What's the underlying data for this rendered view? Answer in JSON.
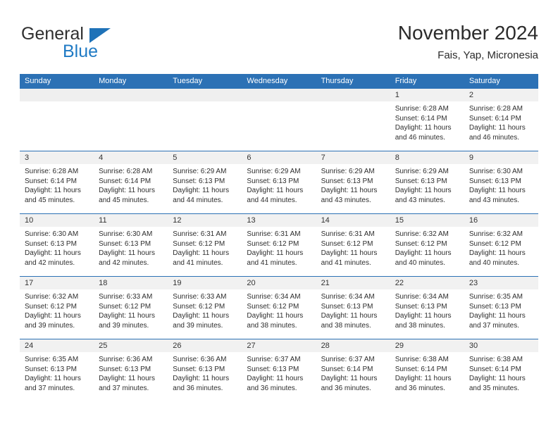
{
  "brand": {
    "word_one": "General",
    "word_two": "Blue",
    "triangle_color": "#1f72b8",
    "blue_color": "#1f7ac4"
  },
  "header": {
    "title": "November 2024",
    "subtitle": "Fais, Yap, Micronesia"
  },
  "theme": {
    "header_blue": "#2c71b5",
    "date_band_gray": "#f1f1f1",
    "text": "#2e2e2e"
  },
  "weekdays": [
    "Sunday",
    "Monday",
    "Tuesday",
    "Wednesday",
    "Thursday",
    "Friday",
    "Saturday"
  ],
  "weeks": [
    [
      {
        "date": "",
        "lines": []
      },
      {
        "date": "",
        "lines": []
      },
      {
        "date": "",
        "lines": []
      },
      {
        "date": "",
        "lines": []
      },
      {
        "date": "",
        "lines": []
      },
      {
        "date": "1",
        "lines": [
          "Sunrise: 6:28 AM",
          "Sunset: 6:14 PM",
          "Daylight: 11 hours",
          "and 46 minutes."
        ]
      },
      {
        "date": "2",
        "lines": [
          "Sunrise: 6:28 AM",
          "Sunset: 6:14 PM",
          "Daylight: 11 hours",
          "and 46 minutes."
        ]
      }
    ],
    [
      {
        "date": "3",
        "lines": [
          "Sunrise: 6:28 AM",
          "Sunset: 6:14 PM",
          "Daylight: 11 hours",
          "and 45 minutes."
        ]
      },
      {
        "date": "4",
        "lines": [
          "Sunrise: 6:28 AM",
          "Sunset: 6:14 PM",
          "Daylight: 11 hours",
          "and 45 minutes."
        ]
      },
      {
        "date": "5",
        "lines": [
          "Sunrise: 6:29 AM",
          "Sunset: 6:13 PM",
          "Daylight: 11 hours",
          "and 44 minutes."
        ]
      },
      {
        "date": "6",
        "lines": [
          "Sunrise: 6:29 AM",
          "Sunset: 6:13 PM",
          "Daylight: 11 hours",
          "and 44 minutes."
        ]
      },
      {
        "date": "7",
        "lines": [
          "Sunrise: 6:29 AM",
          "Sunset: 6:13 PM",
          "Daylight: 11 hours",
          "and 43 minutes."
        ]
      },
      {
        "date": "8",
        "lines": [
          "Sunrise: 6:29 AM",
          "Sunset: 6:13 PM",
          "Daylight: 11 hours",
          "and 43 minutes."
        ]
      },
      {
        "date": "9",
        "lines": [
          "Sunrise: 6:30 AM",
          "Sunset: 6:13 PM",
          "Daylight: 11 hours",
          "and 43 minutes."
        ]
      }
    ],
    [
      {
        "date": "10",
        "lines": [
          "Sunrise: 6:30 AM",
          "Sunset: 6:13 PM",
          "Daylight: 11 hours",
          "and 42 minutes."
        ]
      },
      {
        "date": "11",
        "lines": [
          "Sunrise: 6:30 AM",
          "Sunset: 6:13 PM",
          "Daylight: 11 hours",
          "and 42 minutes."
        ]
      },
      {
        "date": "12",
        "lines": [
          "Sunrise: 6:31 AM",
          "Sunset: 6:12 PM",
          "Daylight: 11 hours",
          "and 41 minutes."
        ]
      },
      {
        "date": "13",
        "lines": [
          "Sunrise: 6:31 AM",
          "Sunset: 6:12 PM",
          "Daylight: 11 hours",
          "and 41 minutes."
        ]
      },
      {
        "date": "14",
        "lines": [
          "Sunrise: 6:31 AM",
          "Sunset: 6:12 PM",
          "Daylight: 11 hours",
          "and 41 minutes."
        ]
      },
      {
        "date": "15",
        "lines": [
          "Sunrise: 6:32 AM",
          "Sunset: 6:12 PM",
          "Daylight: 11 hours",
          "and 40 minutes."
        ]
      },
      {
        "date": "16",
        "lines": [
          "Sunrise: 6:32 AM",
          "Sunset: 6:12 PM",
          "Daylight: 11 hours",
          "and 40 minutes."
        ]
      }
    ],
    [
      {
        "date": "17",
        "lines": [
          "Sunrise: 6:32 AM",
          "Sunset: 6:12 PM",
          "Daylight: 11 hours",
          "and 39 minutes."
        ]
      },
      {
        "date": "18",
        "lines": [
          "Sunrise: 6:33 AM",
          "Sunset: 6:12 PM",
          "Daylight: 11 hours",
          "and 39 minutes."
        ]
      },
      {
        "date": "19",
        "lines": [
          "Sunrise: 6:33 AM",
          "Sunset: 6:12 PM",
          "Daylight: 11 hours",
          "and 39 minutes."
        ]
      },
      {
        "date": "20",
        "lines": [
          "Sunrise: 6:34 AM",
          "Sunset: 6:12 PM",
          "Daylight: 11 hours",
          "and 38 minutes."
        ]
      },
      {
        "date": "21",
        "lines": [
          "Sunrise: 6:34 AM",
          "Sunset: 6:13 PM",
          "Daylight: 11 hours",
          "and 38 minutes."
        ]
      },
      {
        "date": "22",
        "lines": [
          "Sunrise: 6:34 AM",
          "Sunset: 6:13 PM",
          "Daylight: 11 hours",
          "and 38 minutes."
        ]
      },
      {
        "date": "23",
        "lines": [
          "Sunrise: 6:35 AM",
          "Sunset: 6:13 PM",
          "Daylight: 11 hours",
          "and 37 minutes."
        ]
      }
    ],
    [
      {
        "date": "24",
        "lines": [
          "Sunrise: 6:35 AM",
          "Sunset: 6:13 PM",
          "Daylight: 11 hours",
          "and 37 minutes."
        ]
      },
      {
        "date": "25",
        "lines": [
          "Sunrise: 6:36 AM",
          "Sunset: 6:13 PM",
          "Daylight: 11 hours",
          "and 37 minutes."
        ]
      },
      {
        "date": "26",
        "lines": [
          "Sunrise: 6:36 AM",
          "Sunset: 6:13 PM",
          "Daylight: 11 hours",
          "and 36 minutes."
        ]
      },
      {
        "date": "27",
        "lines": [
          "Sunrise: 6:37 AM",
          "Sunset: 6:13 PM",
          "Daylight: 11 hours",
          "and 36 minutes."
        ]
      },
      {
        "date": "28",
        "lines": [
          "Sunrise: 6:37 AM",
          "Sunset: 6:14 PM",
          "Daylight: 11 hours",
          "and 36 minutes."
        ]
      },
      {
        "date": "29",
        "lines": [
          "Sunrise: 6:38 AM",
          "Sunset: 6:14 PM",
          "Daylight: 11 hours",
          "and 36 minutes."
        ]
      },
      {
        "date": "30",
        "lines": [
          "Sunrise: 6:38 AM",
          "Sunset: 6:14 PM",
          "Daylight: 11 hours",
          "and 35 minutes."
        ]
      }
    ]
  ]
}
